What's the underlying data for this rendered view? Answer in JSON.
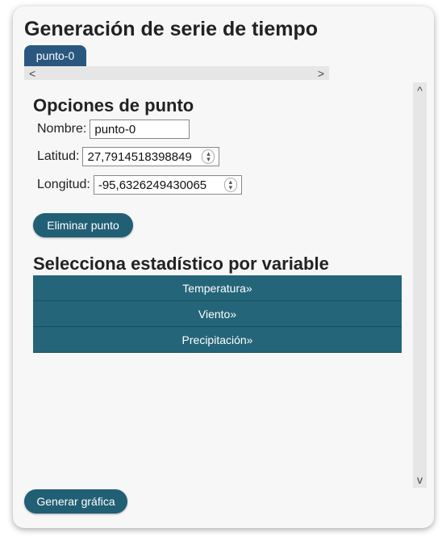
{
  "title": "Generación de serie de tiempo",
  "tabs": [
    {
      "label": "punto-0"
    }
  ],
  "scroll": {
    "left": "<",
    "right": ">",
    "up": "^",
    "down": "v"
  },
  "point_options": {
    "heading": "Opciones de punto",
    "name_label": "Nombre:",
    "name_value": "punto-0",
    "lat_label": "Latitud:",
    "lat_value": "27,7914518398849",
    "lon_label": "Longitud:",
    "lon_value": "-95,6326249430065",
    "delete_label": "Eliminar punto"
  },
  "stats": {
    "heading": "Selecciona estadístico por variable",
    "items": [
      {
        "label": "Temperatura»"
      },
      {
        "label": "Viento»"
      },
      {
        "label": "Precipitación»"
      }
    ]
  },
  "generate_label": "Generar gráfica"
}
